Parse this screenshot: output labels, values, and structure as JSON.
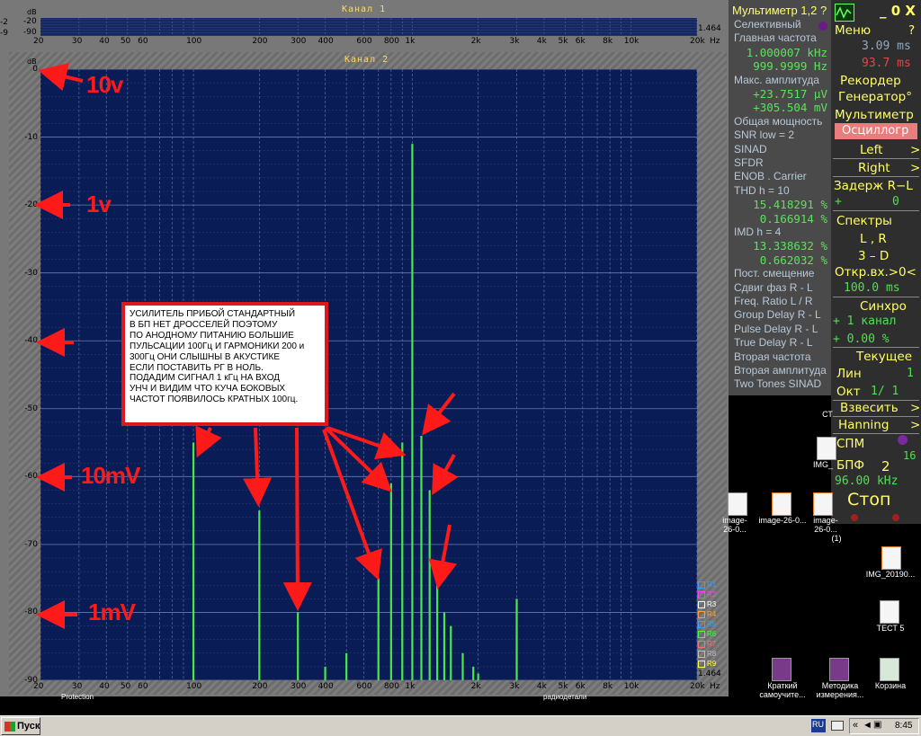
{
  "channel1": {
    "title": "Канал 1",
    "db_label": "dB",
    "y_labels": [
      "-20",
      "-90"
    ],
    "left_edge_labels": [
      "-2",
      "-9"
    ],
    "scale_value": "1.464",
    "x_ticks": [
      "20",
      "30",
      "40",
      "50",
      "60",
      "100",
      "200",
      "300",
      "400",
      "600",
      "800",
      "1k",
      "2k",
      "3k",
      "4k",
      "5k",
      "6k",
      "8k",
      "10k",
      "20k"
    ],
    "hz_label": "Hz"
  },
  "channel2": {
    "title": "Канал 2",
    "db_label": "dB",
    "y_ticks": [
      "0",
      "-10",
      "-20",
      "-30",
      "-40",
      "-50",
      "-60",
      "-70",
      "-80",
      "-90"
    ],
    "x_ticks": [
      "20",
      "30",
      "40",
      "50",
      "60",
      "100",
      "200",
      "300",
      "400",
      "600",
      "800",
      "1k",
      "2k",
      "3k",
      "4k",
      "5k",
      "6k",
      "8k",
      "10k",
      "20k"
    ],
    "hz_label": "Hz",
    "scale_value": "1.464",
    "legend": [
      "R1",
      "R2",
      "R3",
      "R4",
      "R5",
      "R6",
      "R7",
      "R8",
      "R9"
    ],
    "legend_colors": [
      "#3aa0ff",
      "#ff40ff",
      "#ffffff",
      "#ffa040",
      "#40a0ff",
      "#40ff40",
      "#ff7070",
      "#c0c0c0",
      "#ffff40"
    ]
  },
  "chart_data": {
    "type": "bar",
    "title": "Канал 2",
    "xlabel": "Hz",
    "ylabel": "dB",
    "x_scale": "log",
    "xlim": [
      20,
      20000
    ],
    "ylim": [
      -90,
      0
    ],
    "grid": true,
    "series": [
      {
        "x": [
          100,
          200,
          300,
          400,
          500,
          700,
          800,
          900,
          1000,
          1100,
          1200,
          1300,
          1400,
          1500,
          1700,
          1900,
          2000,
          3000
        ],
        "values": [
          -55,
          -65,
          -80,
          -88,
          -86,
          -75,
          -61,
          -55,
          -11,
          -54,
          -62,
          -76,
          -80,
          -82,
          -86,
          -88,
          -89,
          -78
        ]
      }
    ]
  },
  "multimeter": {
    "title": "Мультиметр 1,2 ?",
    "rows": [
      {
        "label": "Селективный"
      },
      {
        "label": "Главная частота"
      },
      {
        "value": "1.000007 kHz"
      },
      {
        "value": "999.9999  Hz"
      },
      {
        "label": "Макс. амплитуда"
      },
      {
        "value": "+23.7517 µV"
      },
      {
        "value": "+305.504 mV"
      },
      {
        "label": "Общая мощность"
      },
      {
        "label": "SNR      low =    2"
      },
      {
        "label": "SINAD"
      },
      {
        "label": "SFDR"
      },
      {
        "label": "ENOB . Carrier"
      },
      {
        "label": "THD      h =    10"
      },
      {
        "value": "15.418291 %"
      },
      {
        "value": "0.166914 %"
      },
      {
        "label": "IMD       h =    4"
      },
      {
        "value": "13.338632 %"
      },
      {
        "value": "0.662032 %"
      },
      {
        "label": "Пост. смещение"
      },
      {
        "label": "Сдвиг фаз R - L"
      },
      {
        "label": "Freq. Ratio  L / R"
      },
      {
        "label": "Group Delay R - L"
      },
      {
        "label": "Pulse Delay R - L"
      },
      {
        "label": "True Delay R - L"
      },
      {
        "label": "Вторая частота"
      },
      {
        "label": "Вторая амплитуда"
      },
      {
        "label": "Two Tones SINAD"
      }
    ]
  },
  "menu": {
    "window_buttons": "_ 0 X",
    "menu_label": "Меню",
    "help": "?",
    "time1": "3.09 ms",
    "time2": "93.7 ms",
    "recorder": "Рекордер",
    "generator": "Генератор°",
    "multimeter": "Мультиметр",
    "oscilloscope": "Осциллогр",
    "left": "Left",
    "right": "Right",
    "arrow": ">",
    "delay": "Задерж  R−L",
    "delay_sign": "+",
    "delay_val": "0",
    "spectra": "Спектры",
    "lr": "L , R",
    "three_d": "3 – D",
    "otkr": "Откр.вх.>0<",
    "otkr_val": "100.0 ms",
    "sync": "Синхро",
    "sync_ch": "+ 1 канал",
    "sync_pct": "+ 0.00 %",
    "current": "Текущее",
    "lin": "Лин",
    "lin_val": "1",
    "okt": "Окт",
    "okt_val": "1/ 1",
    "weigh": "Взвесить",
    "hanning": "Hanning",
    "spm": "СПМ",
    "bpf": "БПФ",
    "bpf_exp": "2",
    "bpf_pow": "16",
    "rate": "96.00 kHz",
    "stop": "Стоп"
  },
  "annotations": {
    "l10v": "10v",
    "l1v": "1v",
    "l10mv": "10mV",
    "l1mv": "1mV",
    "note_lines": [
      "УСИЛИТЕЛЬ ПРИБОЙ СТАНДАРТНЫЙ",
      "В БП НЕТ ДРОССЕЛЕЙ ПОЭТОМУ",
      "ПО АНОДНОМУ ПИТАНИЮ БОЛЬШИЕ",
      "ПУЛЬСАЦИИ 100Гц И ГАРМОНИКИ 200 и",
      "300Гц ОНИ СЛЫШНЫ В АКУСТИКЕ",
      "ЕСЛИ ПОСТАВИТЬ РГ В НОЛЬ.",
      "ПОДАДИМ СИГНАЛ 1 кГц НА ВХОД",
      "УНЧ И ВИДИМ ЧТО КУЧА БОКОВЫХ",
      " ЧАСТОТ ПОЯВИЛОСЬ КРАТНЫХ 100гц."
    ]
  },
  "desktop": {
    "icons": [
      {
        "label": "СТ"
      },
      {
        "label": "IMG_"
      },
      {
        "label": "image-26-0..."
      },
      {
        "label": "image-26-0..."
      },
      {
        "label": "image-26-0..."
      },
      {
        "label": "(1)"
      },
      {
        "label": "IMG_20190..."
      },
      {
        "label": "ТЕСТ 5"
      },
      {
        "label": "Краткий самоучите..."
      },
      {
        "label": "Методика измерения..."
      },
      {
        "label": "Корзина"
      }
    ],
    "bottom_texts": [
      "Protection",
      "радиодетали"
    ]
  },
  "taskbar": {
    "start": "Пуск",
    "lang": "RU",
    "time": "8:45"
  }
}
